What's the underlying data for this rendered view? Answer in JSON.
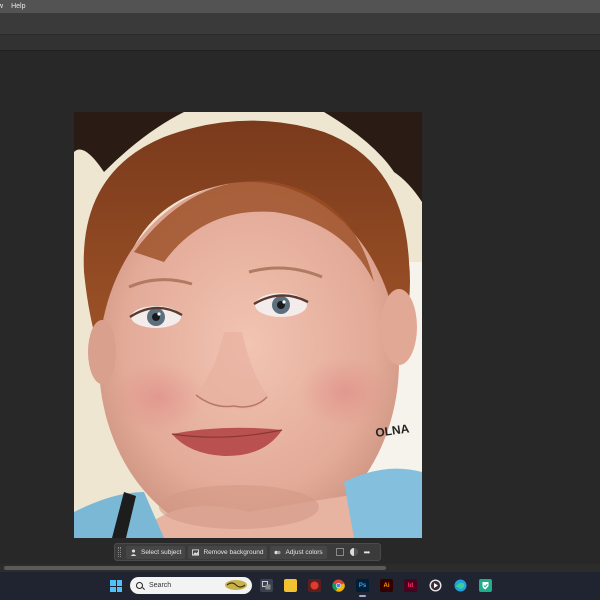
{
  "menu": {
    "items": [
      "w",
      "Help"
    ]
  },
  "context_bar": {
    "select_subject": "Select subject",
    "remove_background": "Remove background",
    "adjust_colors": "Adjust colors",
    "more": "•••"
  },
  "taskbar": {
    "search_placeholder": "Search",
    "apps": [
      {
        "icon": "task-view-icon",
        "label": ""
      },
      {
        "icon": "file-explorer-icon",
        "label": ""
      },
      {
        "icon": "red-app-icon",
        "label": ""
      },
      {
        "icon": "chrome-icon",
        "label": ""
      },
      {
        "icon": "photoshop-icon",
        "label": "Ps"
      },
      {
        "icon": "illustrator-icon",
        "label": "Ai"
      },
      {
        "icon": "indesign-icon",
        "label": "Id"
      },
      {
        "icon": "media-player-icon",
        "label": ""
      },
      {
        "icon": "edge-icon",
        "label": ""
      },
      {
        "icon": "security-icon",
        "label": ""
      }
    ]
  },
  "colors": {
    "menubar": "#535353",
    "canvas": "#282828",
    "taskbar": "#1f2430",
    "accent": "#4cc2ff"
  }
}
